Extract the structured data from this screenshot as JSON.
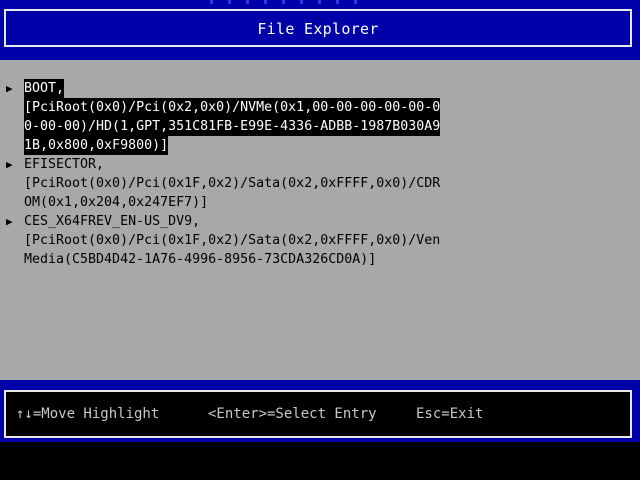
{
  "header": {
    "title": "File Explorer"
  },
  "entries": [
    {
      "highlighted": true,
      "lines": [
        "BOOT,",
        "[PciRoot(0x0)/Pci(0x2,0x0)/NVMe(0x1,00-00-00-00-00-0",
        "0-00-00)/HD(1,GPT,351C81FB-E99E-4336-ADBB-1987B030A9",
        "1B,0x800,0xF9800)]"
      ]
    },
    {
      "highlighted": false,
      "lines": [
        "EFISECTOR,",
        "[PciRoot(0x0)/Pci(0x1F,0x2)/Sata(0x2,0xFFFF,0x0)/CDR",
        "OM(0x1,0x204,0x247EF7)]"
      ]
    },
    {
      "highlighted": false,
      "lines": [
        "CES_X64FREV_EN-US_DV9,",
        "[PciRoot(0x0)/Pci(0x1F,0x2)/Sata(0x2,0xFFFF,0x0)/Ven",
        "Media(C5BD4D42-1A76-4996-8956-73CDA326CD0A)]"
      ]
    }
  ],
  "arrow_icon": "▶",
  "footer": {
    "move_hint": "↑↓=Move Highlight",
    "select_hint": "<Enter>=Select Entry",
    "exit_hint": "Esc=Exit"
  },
  "colors": {
    "header_bg": "#0000a8",
    "panel_bg": "#a8a8a8",
    "highlight_bg": "#000000",
    "highlight_fg": "#ffffff",
    "footer_bg": "#000000"
  }
}
